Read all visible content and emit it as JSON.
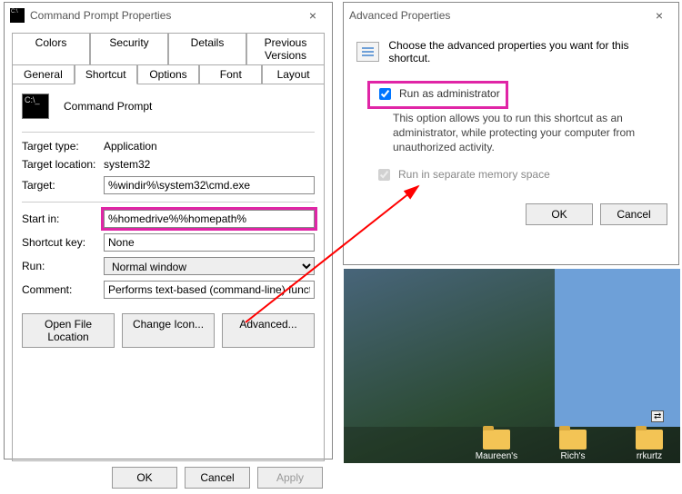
{
  "props": {
    "title": "Command Prompt Properties",
    "tabs_top": [
      "Colors",
      "Security",
      "Details",
      "Previous Versions"
    ],
    "tabs_bot": [
      "General",
      "Shortcut",
      "Options",
      "Font",
      "Layout"
    ],
    "active_tab": "Shortcut",
    "app_name": "Command Prompt",
    "target_type_lbl": "Target type:",
    "target_type": "Application",
    "target_loc_lbl": "Target location:",
    "target_loc": "system32",
    "target_lbl": "Target:",
    "target": "%windir%\\system32\\cmd.exe",
    "startin_lbl": "Start in:",
    "startin": "%homedrive%%homepath%",
    "shortcut_lbl": "Shortcut key:",
    "shortcut": "None",
    "run_lbl": "Run:",
    "run": "Normal window",
    "comment_lbl": "Comment:",
    "comment": "Performs text-based (command-line) functions.",
    "btn_openloc": "Open File Location",
    "btn_changeicon": "Change Icon...",
    "btn_advanced": "Advanced...",
    "btn_ok": "OK",
    "btn_cancel": "Cancel",
    "btn_apply": "Apply"
  },
  "adv": {
    "title": "Advanced Properties",
    "intro": "Choose the advanced properties you want for this shortcut.",
    "runas_lbl": "Run as administrator",
    "runas_checked": true,
    "runas_desc": "This option allows you to run this shortcut as an administrator, while protecting your computer from unauthorized activity.",
    "sep_lbl": "Run in separate memory space",
    "sep_checked": true,
    "btn_ok": "OK",
    "btn_cancel": "Cancel"
  },
  "desktop": {
    "icons": [
      "Maureen's",
      "Rich's",
      "rrkurtz"
    ]
  },
  "colors": {
    "highlight": "#e025a6",
    "arrow": "#ff0000"
  }
}
